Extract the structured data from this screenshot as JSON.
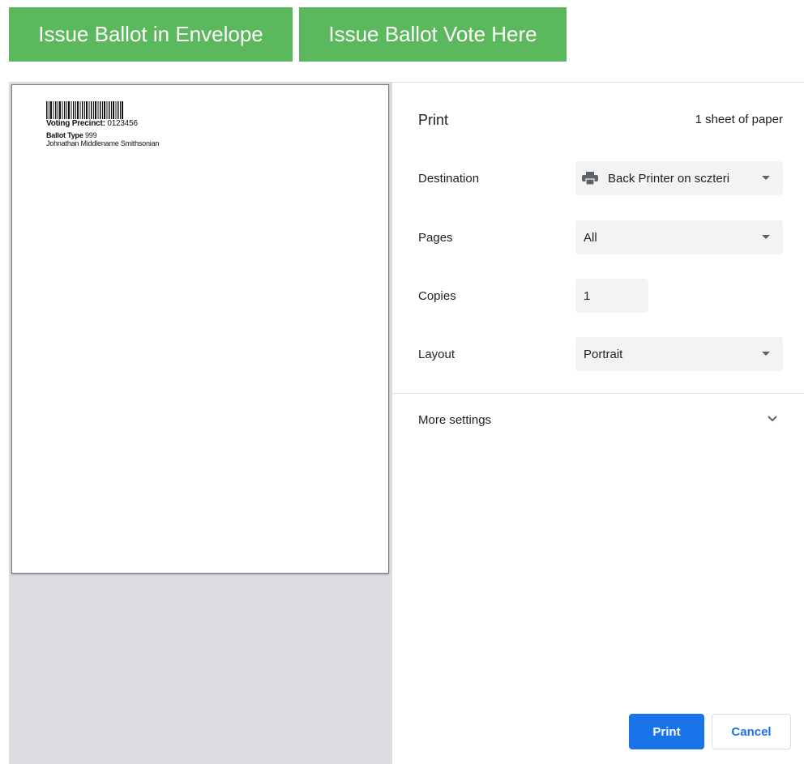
{
  "top_buttons": {
    "envelope_label": "Issue Ballot in Envelope",
    "vote_here_label": "Issue Ballot Vote Here",
    "color": "#5cb85c"
  },
  "preview": {
    "precinct_label": "Voting Precinct:",
    "precinct_value": "0123456",
    "ballot_type_label": "Ballot Type",
    "ballot_type_value": "999",
    "voter_name": "Johnathan Middlename Smithsonian"
  },
  "print_panel": {
    "title": "Print",
    "sheet_count": "1 sheet of paper",
    "destination_label": "Destination",
    "destination_value": "Back Printer on sczteri",
    "pages_label": "Pages",
    "pages_value": "All",
    "copies_label": "Copies",
    "copies_value": "1",
    "layout_label": "Layout",
    "layout_value": "Portrait",
    "more_settings_label": "More settings",
    "print_button": "Print",
    "cancel_button": "Cancel",
    "accent_color": "#1a73e8"
  }
}
